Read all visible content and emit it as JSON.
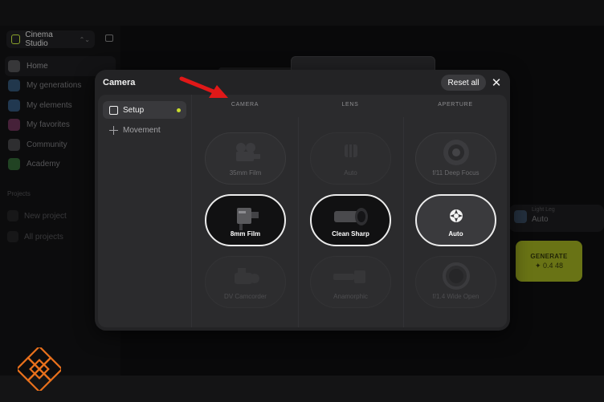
{
  "app": {
    "name": "Cinema Studio"
  },
  "sidebar": {
    "items": [
      {
        "label": "Home",
        "icon": "home-icon",
        "color": "#5d5d60"
      },
      {
        "label": "My generations",
        "icon": "generations-icon",
        "color": "#3c5a7a"
      },
      {
        "label": "My elements",
        "icon": "elements-icon",
        "color": "#3b5d82"
      },
      {
        "label": "My favorites",
        "icon": "favorites-icon",
        "color": "#7a3c62"
      },
      {
        "label": "Community",
        "icon": "community-icon",
        "color": "#5a5a5c"
      },
      {
        "label": "Academy",
        "icon": "academy-icon",
        "color": "#3c6b3e"
      }
    ],
    "projects_label": "Projects",
    "new_project": "New project",
    "all_projects": "All projects"
  },
  "background": {
    "model_label": "Light Leg",
    "model_value": "Auto",
    "generate_label": "GENERATE",
    "generate_cost": "✦ 0.4 48",
    "generate_color": "#8c9a1c"
  },
  "modal": {
    "title": "Camera",
    "reset_label": "Reset all",
    "close_icon": "close-icon",
    "tabs": [
      {
        "label": "Setup",
        "icon": "setup-icon",
        "active": true
      },
      {
        "label": "Movement",
        "icon": "move-icon",
        "active": false
      }
    ],
    "columns": [
      {
        "header": "CAMERA",
        "options": [
          {
            "label": "35mm Film",
            "state": "normal"
          },
          {
            "label": "8mm Film",
            "state": "selected"
          },
          {
            "label": "DV Camcorder",
            "state": "faded"
          }
        ]
      },
      {
        "header": "LENS",
        "options": [
          {
            "label": "Auto",
            "state": "faded"
          },
          {
            "label": "Clean Sharp",
            "state": "selected"
          },
          {
            "label": "Anamorphic",
            "state": "faded"
          }
        ]
      },
      {
        "header": "APERTURE",
        "options": [
          {
            "label": "f/11 Deep Focus",
            "state": "normal"
          },
          {
            "label": "Auto",
            "state": "grey-selected"
          },
          {
            "label": "f/1.4 Wide Open",
            "state": "faded"
          }
        ]
      }
    ]
  },
  "accent_color": "#c8dc2d",
  "annotation_arrow_color": "#e01818"
}
